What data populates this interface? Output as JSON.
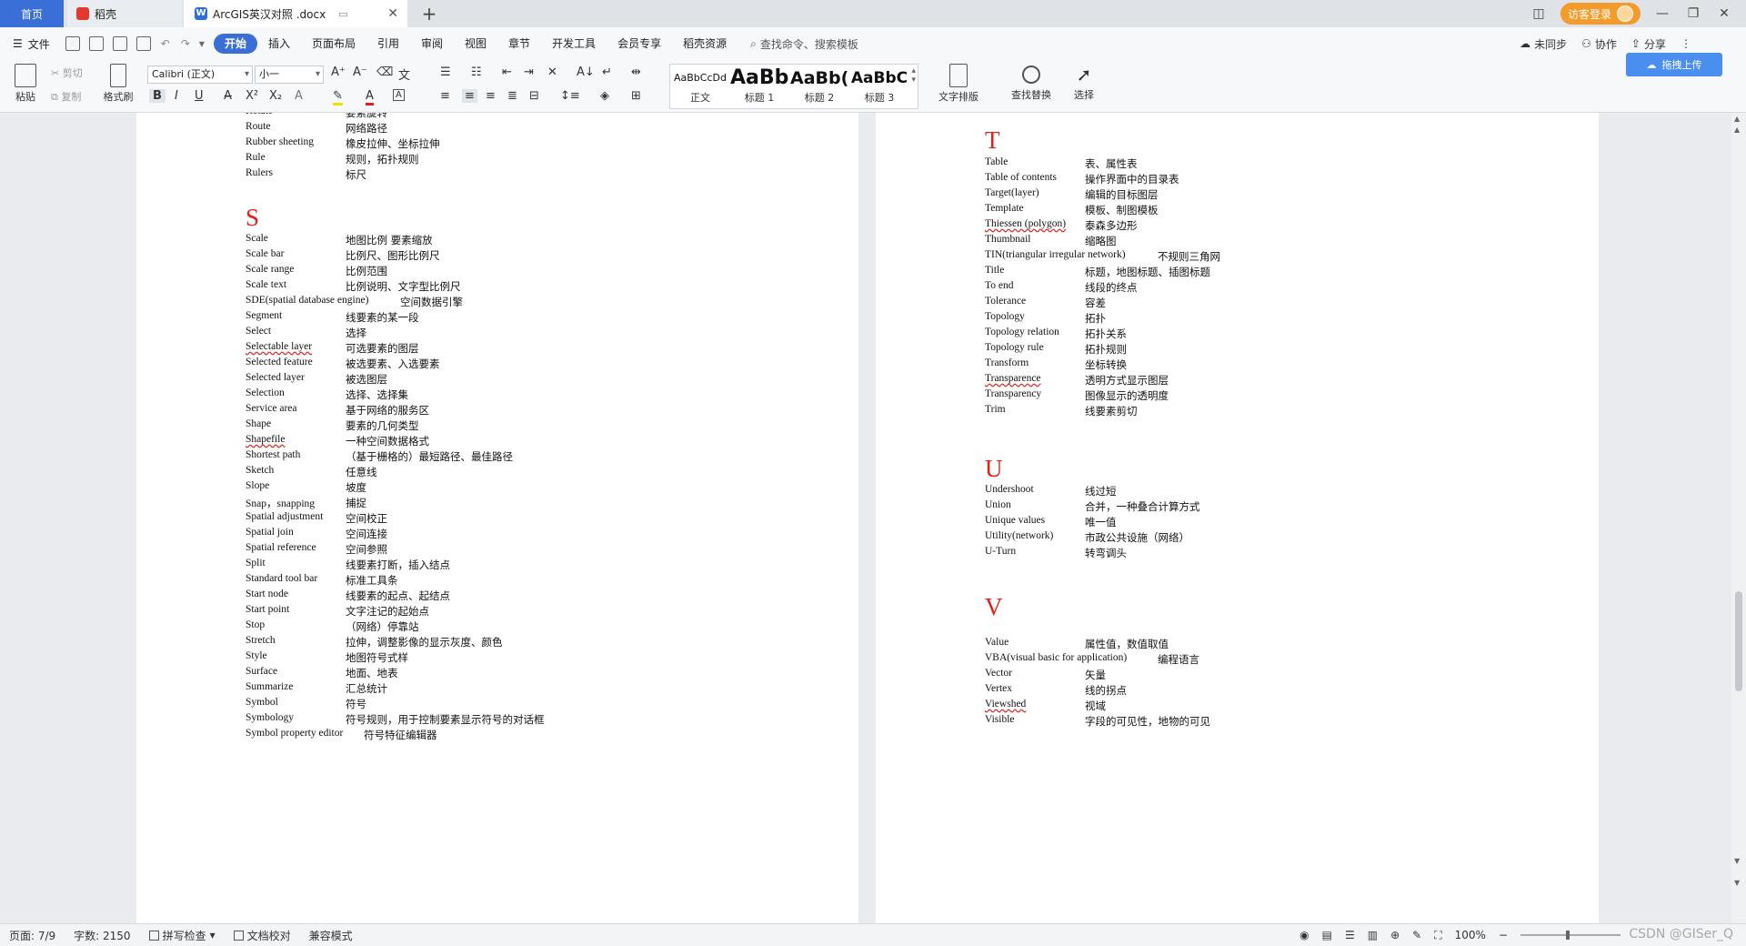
{
  "tabs": {
    "home": "首页",
    "daoke": "稻壳",
    "document": "ArcGIS英汉对照 .docx"
  },
  "window": {
    "visitor_login": "访客登录"
  },
  "menu": {
    "file": "文件",
    "items": [
      "开始",
      "插入",
      "页面布局",
      "引用",
      "审阅",
      "视图",
      "章节",
      "开发工具",
      "会员专享",
      "稻壳资源"
    ],
    "search_placeholder": "查找命令、搜索模板",
    "sync": "未同步",
    "collab": "协作",
    "share": "分享"
  },
  "ribbon": {
    "paste": "粘贴",
    "cut": "剪切",
    "copy": "复制",
    "format_painter": "格式刷",
    "font_name": "Calibri (正文)",
    "font_size": "小一",
    "styles": [
      {
        "preview": "AaBbCcDd",
        "name": "正文"
      },
      {
        "preview": "AaBb",
        "name": "标题 1"
      },
      {
        "preview": "AaBb(",
        "name": "标题 2"
      },
      {
        "preview": "AaBbC",
        "name": "标题 3"
      }
    ],
    "text_layout": "文字排版",
    "find_replace": "查找替换",
    "select": "选择",
    "cloud_upload": "拖拽上传"
  },
  "document": {
    "left": {
      "top_entries": [
        {
          "term": "Rotate",
          "cn": "要素旋转"
        },
        {
          "term": "Route",
          "cn": "网络路径"
        },
        {
          "term": "Rubber sheeting",
          "cn": "橡皮拉伸、坐标拉伸"
        },
        {
          "term": "Rule",
          "cn": "规则，拓扑规则"
        },
        {
          "term": "Rulers",
          "cn": "标尺"
        }
      ],
      "section_letter": "S",
      "entries": [
        {
          "term": "Scale",
          "cn": "地图比例  要素缩放"
        },
        {
          "term": "Scale bar",
          "cn": "比例尺、图形比例尺"
        },
        {
          "term": "Scale range",
          "cn": "比例范围"
        },
        {
          "term": "Scale text",
          "cn": "比例说明、文字型比例尺"
        },
        {
          "term": "SDE(spatial database engine)",
          "cn": "空间数据引擎"
        },
        {
          "term": "Segment",
          "cn": "线要素的某一段"
        },
        {
          "term": "Select",
          "cn": "选择"
        },
        {
          "term": "Selectable layer",
          "cn": "可选要素的图层"
        },
        {
          "term": "Selected feature",
          "cn": "被选要素、入选要素"
        },
        {
          "term": "Selected layer",
          "cn": "被选图层"
        },
        {
          "term": "Selection",
          "cn": "选择、选择集"
        },
        {
          "term": "Service area",
          "cn": "基于网络的服务区"
        },
        {
          "term": "Shape",
          "cn": "要素的几何类型"
        },
        {
          "term": "Shapefile",
          "cn": "一种空间数据格式"
        },
        {
          "term": "Shortest path",
          "cn": "（基于栅格的）最短路径、最佳路径"
        },
        {
          "term": "Sketch",
          "cn": "任意线"
        },
        {
          "term": "Slope",
          "cn": "坡度"
        },
        {
          "term": "Snap，snapping",
          "cn": "捕捉"
        },
        {
          "term": "Spatial adjustment",
          "cn": "空间校正"
        },
        {
          "term": "Spatial join",
          "cn": "空间连接"
        },
        {
          "term": "Spatial reference",
          "cn": "空间参照"
        },
        {
          "term": "Split",
          "cn": "线要素打断，插入结点"
        },
        {
          "term": "Standard tool bar",
          "cn": "标准工具条"
        },
        {
          "term": "Start node",
          "cn": "线要素的起点、起结点"
        },
        {
          "term": "Start point",
          "cn": "文字注记的起始点"
        },
        {
          "term": "Stop",
          "cn": "（网络）停靠站"
        },
        {
          "term": "Stretch",
          "cn": "拉伸，调整影像的显示灰度、颜色"
        },
        {
          "term": "Style",
          "cn": "地图符号式样"
        },
        {
          "term": "Surface",
          "cn": "地面、地表"
        },
        {
          "term": "Summarize",
          "cn": "汇总统计"
        },
        {
          "term": "Symbol",
          "cn": "符号"
        },
        {
          "term": "Symbology",
          "cn": "符号规则，用于控制要素显示符号的对话框"
        },
        {
          "term": "Symbol property editor",
          "cn": "符号特征编辑器"
        }
      ]
    },
    "right": {
      "sections": [
        {
          "letter": "T",
          "entries": [
            {
              "term": "Table",
              "cn": "表、属性表"
            },
            {
              "term": "Table of contents",
              "cn": "操作界面中的目录表"
            },
            {
              "term": "Target(layer)",
              "cn": "编辑的目标图层"
            },
            {
              "term": "Template",
              "cn": "模板、制图模板"
            },
            {
              "term": "Thiessen (polygon)",
              "cn": "泰森多边形"
            },
            {
              "term": "Thumbnail",
              "cn": "缩略图"
            },
            {
              "term": "TIN(triangular irregular network)",
              "cn": "不规则三角网"
            },
            {
              "term": "Title",
              "cn": "标题，地图标题、插图标题"
            },
            {
              "term": "To end",
              "cn": "线段的终点"
            },
            {
              "term": "Tolerance",
              "cn": "容差"
            },
            {
              "term": "Topology",
              "cn": "拓扑"
            },
            {
              "term": "Topology relation",
              "cn": "拓扑关系"
            },
            {
              "term": "Topology rule",
              "cn": "拓扑规则"
            },
            {
              "term": "Transform",
              "cn": "坐标转换"
            },
            {
              "term": "Transparence",
              "cn": "透明方式显示图层"
            },
            {
              "term": "Transparency",
              "cn": "图像显示的透明度"
            },
            {
              "term": "Trim",
              "cn": "线要素剪切"
            }
          ]
        },
        {
          "letter": "U",
          "entries": [
            {
              "term": "Undershoot",
              "cn": "线过短"
            },
            {
              "term": "Union",
              "cn": "合并，一种叠合计算方式"
            },
            {
              "term": "Unique values",
              "cn": "唯一值"
            },
            {
              "term": "Utility(network)",
              "cn": "市政公共设施（网络）"
            },
            {
              "term": "U-Turn",
              "cn": "转弯调头"
            }
          ]
        },
        {
          "letter": "V",
          "entries": [
            {
              "term": "Value",
              "cn": "属性值，数值取值"
            },
            {
              "term": "VBA(visual basic for application)",
              "cn": "编程语言"
            },
            {
              "term": "Vector",
              "cn": "矢量"
            },
            {
              "term": "Vertex",
              "cn": "线的拐点"
            },
            {
              "term": "Viewshed",
              "cn": "视域"
            },
            {
              "term": "Visible",
              "cn": "字段的可见性，地物的可见"
            }
          ]
        }
      ]
    }
  },
  "status": {
    "page": "页面: 7/9",
    "words": "字数: 2150",
    "spell_check": "拼写检查",
    "doc_proof": "文档校对",
    "compat_mode": "兼容模式",
    "zoom": "100%",
    "watermark": "CSDN @GISer_Q"
  }
}
